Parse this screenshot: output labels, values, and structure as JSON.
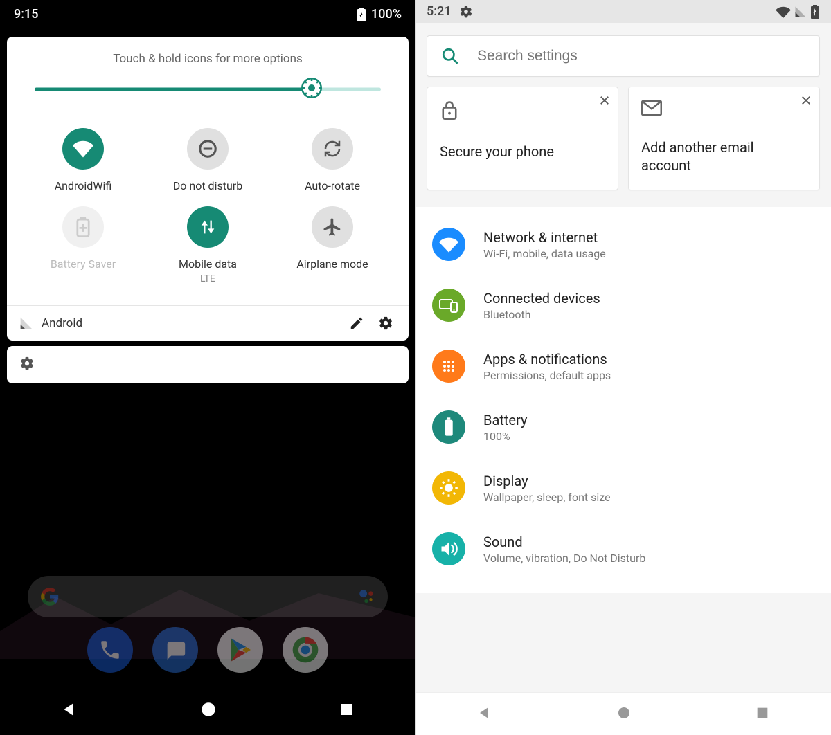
{
  "left": {
    "status": {
      "time": "9:15",
      "battery": "100%"
    },
    "qs": {
      "hint": "Touch & hold icons for more options",
      "brightness_pct": 80,
      "tiles": [
        {
          "name": "wifi",
          "label": "AndroidWifi",
          "sublabel": "",
          "state": "active"
        },
        {
          "name": "dnd",
          "label": "Do not disturb",
          "sublabel": "",
          "state": "inactive"
        },
        {
          "name": "rotate",
          "label": "Auto-rotate",
          "sublabel": "",
          "state": "inactive"
        },
        {
          "name": "battery-saver",
          "label": "Battery Saver",
          "sublabel": "",
          "state": "disabled"
        },
        {
          "name": "mobile-data",
          "label": "Mobile data",
          "sublabel": "LTE",
          "state": "active"
        },
        {
          "name": "airplane",
          "label": "Airplane mode",
          "sublabel": "",
          "state": "inactive"
        }
      ],
      "carrier": "Android"
    }
  },
  "right": {
    "status": {
      "time": "5:21"
    },
    "search": {
      "placeholder": "Search settings"
    },
    "suggestions": [
      {
        "icon": "lock",
        "text": "Secure your phone"
      },
      {
        "icon": "gmail",
        "text": "Add another email account"
      }
    ],
    "settings": [
      {
        "icon": "wifi",
        "color": "#1a8cff",
        "title": "Network & internet",
        "sub": "Wi-Fi, mobile, data usage"
      },
      {
        "icon": "devices",
        "color": "#6aa929",
        "title": "Connected devices",
        "sub": "Bluetooth"
      },
      {
        "icon": "apps",
        "color": "#ff7a1a",
        "title": "Apps & notifications",
        "sub": "Permissions, default apps"
      },
      {
        "icon": "battery",
        "color": "#1e897b",
        "title": "Battery",
        "sub": "100%"
      },
      {
        "icon": "display",
        "color": "#f2b705",
        "title": "Display",
        "sub": "Wallpaper, sleep, font size"
      },
      {
        "icon": "sound",
        "color": "#17b1a8",
        "title": "Sound",
        "sub": "Volume, vibration, Do Not Disturb"
      }
    ]
  }
}
